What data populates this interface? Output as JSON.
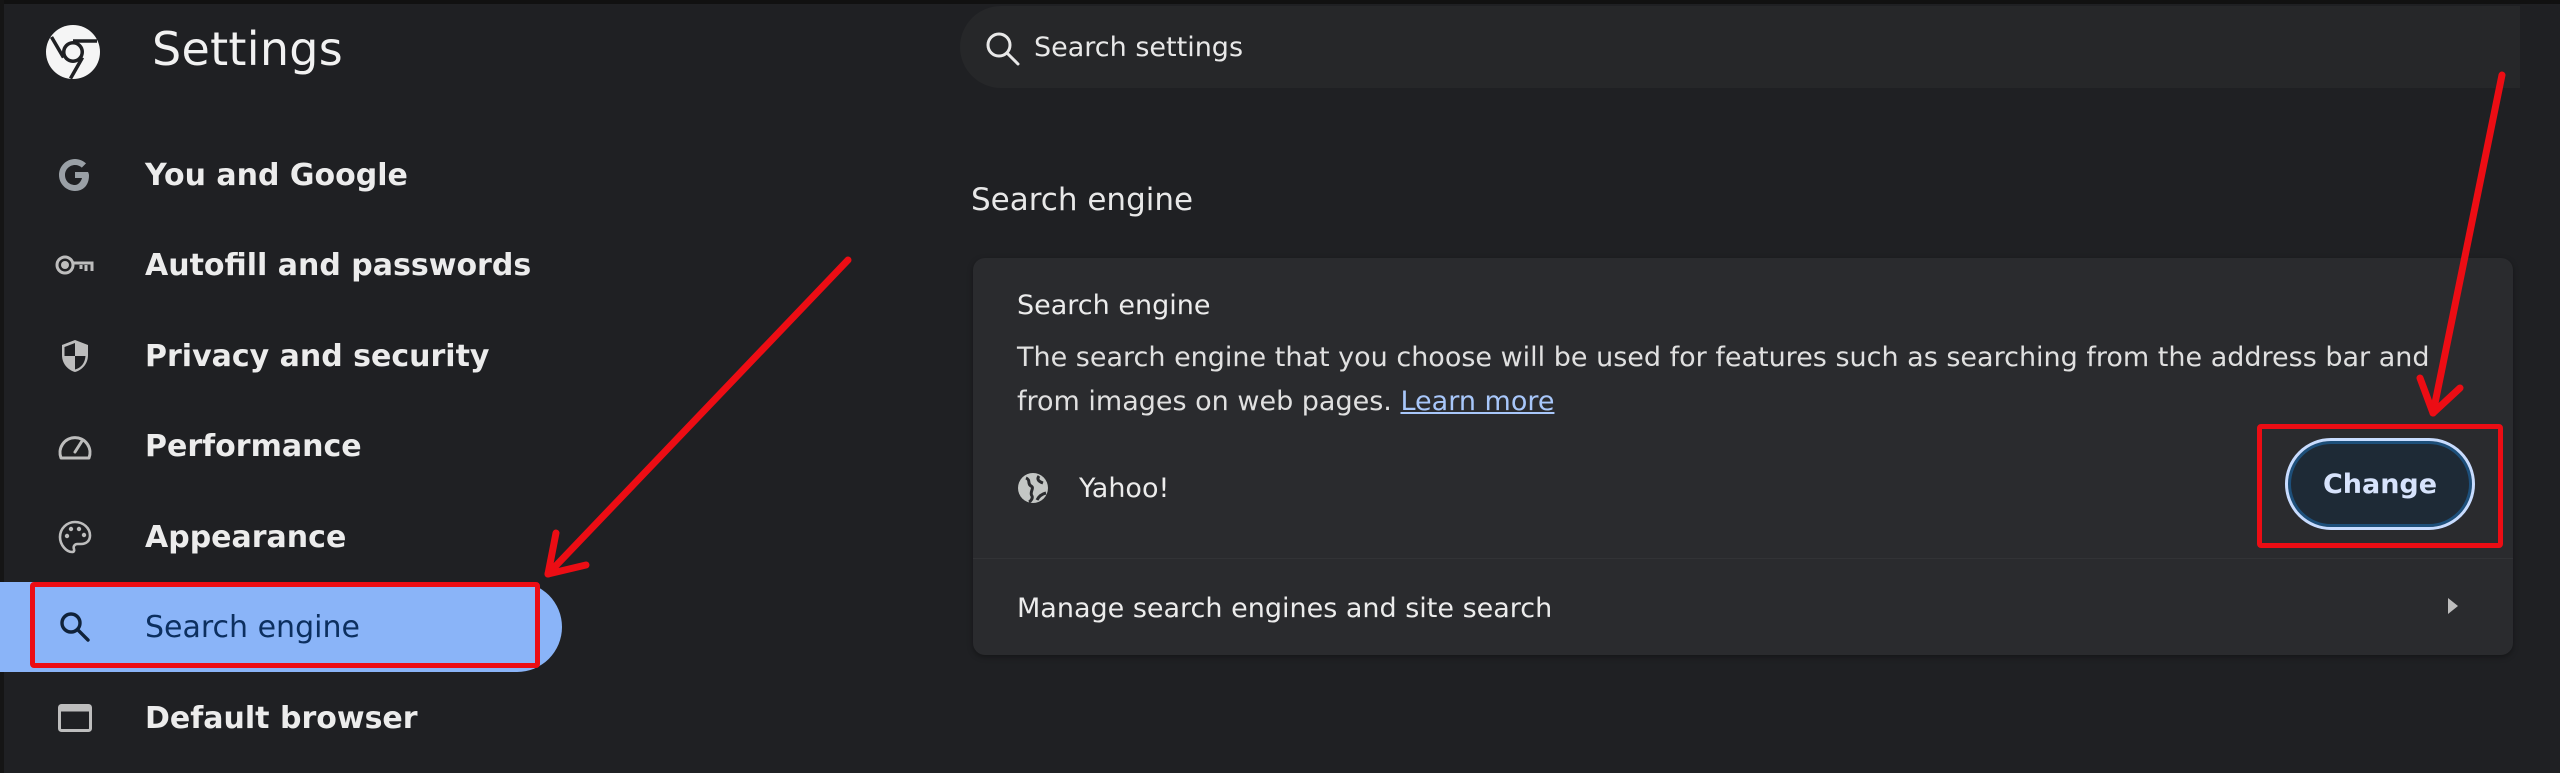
{
  "header": {
    "title": "Settings",
    "logo_icon": "chrome-logo-icon"
  },
  "search": {
    "placeholder": "Search settings",
    "value": "",
    "icon": "search-icon"
  },
  "sidebar": {
    "items": [
      {
        "label": "You and Google",
        "icon": "google-g-icon",
        "selected": false
      },
      {
        "label": "Autofill and passwords",
        "icon": "key-icon",
        "selected": false
      },
      {
        "label": "Privacy and security",
        "icon": "shield-icon",
        "selected": false
      },
      {
        "label": "Performance",
        "icon": "speedometer-icon",
        "selected": false
      },
      {
        "label": "Appearance",
        "icon": "palette-icon",
        "selected": false
      },
      {
        "label": "Search engine",
        "icon": "search-icon",
        "selected": true
      },
      {
        "label": "Default browser",
        "icon": "browser-window-icon",
        "selected": false
      }
    ]
  },
  "main": {
    "section_title": "Search engine",
    "card": {
      "title": "Search engine",
      "description": "The search engine that you choose will be used for features such as searching from the address bar and from images on web pages.",
      "learn_more": "Learn more",
      "current_engine": "Yahoo!",
      "engine_icon": "globe-icon",
      "change_label": "Change",
      "manage_label": "Manage search engines and site search",
      "manage_icon": "arrow-right-icon"
    }
  },
  "annotations": {
    "color": "#ec0d14",
    "highlights": [
      "sidebar-item-search-engine",
      "change-button"
    ]
  },
  "colors": {
    "background": "#1f2023",
    "card": "#2a2b2e",
    "selected": "#8ab4f8",
    "link": "#a8c7fa"
  }
}
